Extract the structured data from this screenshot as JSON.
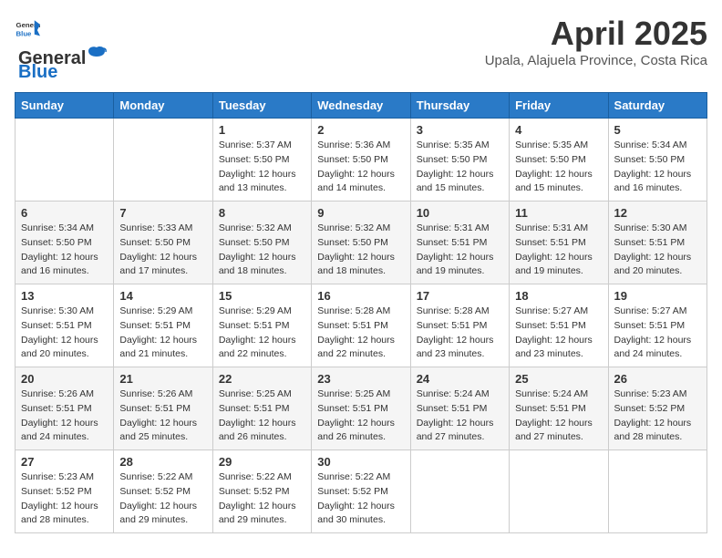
{
  "logo": {
    "general": "General",
    "blue": "Blue"
  },
  "title": "April 2025",
  "location": "Upala, Alajuela Province, Costa Rica",
  "days_of_week": [
    "Sunday",
    "Monday",
    "Tuesday",
    "Wednesday",
    "Thursday",
    "Friday",
    "Saturday"
  ],
  "weeks": [
    [
      {
        "day": "",
        "info": ""
      },
      {
        "day": "",
        "info": ""
      },
      {
        "day": "1",
        "info": "Sunrise: 5:37 AM\nSunset: 5:50 PM\nDaylight: 12 hours and 13 minutes."
      },
      {
        "day": "2",
        "info": "Sunrise: 5:36 AM\nSunset: 5:50 PM\nDaylight: 12 hours and 14 minutes."
      },
      {
        "day": "3",
        "info": "Sunrise: 5:35 AM\nSunset: 5:50 PM\nDaylight: 12 hours and 15 minutes."
      },
      {
        "day": "4",
        "info": "Sunrise: 5:35 AM\nSunset: 5:50 PM\nDaylight: 12 hours and 15 minutes."
      },
      {
        "day": "5",
        "info": "Sunrise: 5:34 AM\nSunset: 5:50 PM\nDaylight: 12 hours and 16 minutes."
      }
    ],
    [
      {
        "day": "6",
        "info": "Sunrise: 5:34 AM\nSunset: 5:50 PM\nDaylight: 12 hours and 16 minutes."
      },
      {
        "day": "7",
        "info": "Sunrise: 5:33 AM\nSunset: 5:50 PM\nDaylight: 12 hours and 17 minutes."
      },
      {
        "day": "8",
        "info": "Sunrise: 5:32 AM\nSunset: 5:50 PM\nDaylight: 12 hours and 18 minutes."
      },
      {
        "day": "9",
        "info": "Sunrise: 5:32 AM\nSunset: 5:50 PM\nDaylight: 12 hours and 18 minutes."
      },
      {
        "day": "10",
        "info": "Sunrise: 5:31 AM\nSunset: 5:51 PM\nDaylight: 12 hours and 19 minutes."
      },
      {
        "day": "11",
        "info": "Sunrise: 5:31 AM\nSunset: 5:51 PM\nDaylight: 12 hours and 19 minutes."
      },
      {
        "day": "12",
        "info": "Sunrise: 5:30 AM\nSunset: 5:51 PM\nDaylight: 12 hours and 20 minutes."
      }
    ],
    [
      {
        "day": "13",
        "info": "Sunrise: 5:30 AM\nSunset: 5:51 PM\nDaylight: 12 hours and 20 minutes."
      },
      {
        "day": "14",
        "info": "Sunrise: 5:29 AM\nSunset: 5:51 PM\nDaylight: 12 hours and 21 minutes."
      },
      {
        "day": "15",
        "info": "Sunrise: 5:29 AM\nSunset: 5:51 PM\nDaylight: 12 hours and 22 minutes."
      },
      {
        "day": "16",
        "info": "Sunrise: 5:28 AM\nSunset: 5:51 PM\nDaylight: 12 hours and 22 minutes."
      },
      {
        "day": "17",
        "info": "Sunrise: 5:28 AM\nSunset: 5:51 PM\nDaylight: 12 hours and 23 minutes."
      },
      {
        "day": "18",
        "info": "Sunrise: 5:27 AM\nSunset: 5:51 PM\nDaylight: 12 hours and 23 minutes."
      },
      {
        "day": "19",
        "info": "Sunrise: 5:27 AM\nSunset: 5:51 PM\nDaylight: 12 hours and 24 minutes."
      }
    ],
    [
      {
        "day": "20",
        "info": "Sunrise: 5:26 AM\nSunset: 5:51 PM\nDaylight: 12 hours and 24 minutes."
      },
      {
        "day": "21",
        "info": "Sunrise: 5:26 AM\nSunset: 5:51 PM\nDaylight: 12 hours and 25 minutes."
      },
      {
        "day": "22",
        "info": "Sunrise: 5:25 AM\nSunset: 5:51 PM\nDaylight: 12 hours and 26 minutes."
      },
      {
        "day": "23",
        "info": "Sunrise: 5:25 AM\nSunset: 5:51 PM\nDaylight: 12 hours and 26 minutes."
      },
      {
        "day": "24",
        "info": "Sunrise: 5:24 AM\nSunset: 5:51 PM\nDaylight: 12 hours and 27 minutes."
      },
      {
        "day": "25",
        "info": "Sunrise: 5:24 AM\nSunset: 5:51 PM\nDaylight: 12 hours and 27 minutes."
      },
      {
        "day": "26",
        "info": "Sunrise: 5:23 AM\nSunset: 5:52 PM\nDaylight: 12 hours and 28 minutes."
      }
    ],
    [
      {
        "day": "27",
        "info": "Sunrise: 5:23 AM\nSunset: 5:52 PM\nDaylight: 12 hours and 28 minutes."
      },
      {
        "day": "28",
        "info": "Sunrise: 5:22 AM\nSunset: 5:52 PM\nDaylight: 12 hours and 29 minutes."
      },
      {
        "day": "29",
        "info": "Sunrise: 5:22 AM\nSunset: 5:52 PM\nDaylight: 12 hours and 29 minutes."
      },
      {
        "day": "30",
        "info": "Sunrise: 5:22 AM\nSunset: 5:52 PM\nDaylight: 12 hours and 30 minutes."
      },
      {
        "day": "",
        "info": ""
      },
      {
        "day": "",
        "info": ""
      },
      {
        "day": "",
        "info": ""
      }
    ]
  ]
}
